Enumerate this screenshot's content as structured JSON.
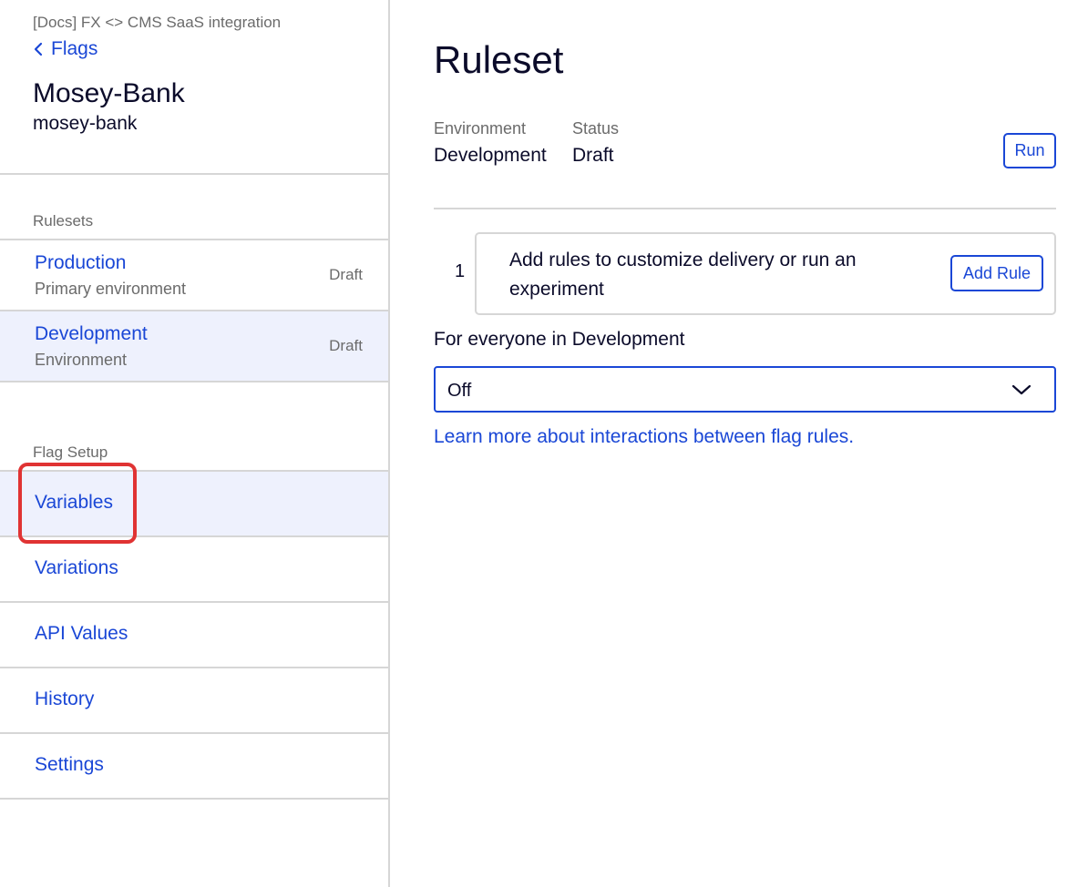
{
  "sidebar": {
    "project_name": "[Docs] FX <> CMS SaaS integration",
    "back_label": "Flags",
    "flag_name": "Mosey-Bank",
    "flag_key": "mosey-bank",
    "rulesets_heading": "Rulesets",
    "environments": [
      {
        "name": "Production",
        "subtitle": "Primary environment",
        "status": "Draft",
        "selected": false
      },
      {
        "name": "Development",
        "subtitle": "Environment",
        "status": "Draft",
        "selected": true
      }
    ],
    "flag_setup_heading": "Flag Setup",
    "setup_items": [
      {
        "label": "Variables",
        "active": true,
        "highlighted": true
      },
      {
        "label": "Variations",
        "active": false
      },
      {
        "label": "API Values",
        "active": false
      },
      {
        "label": "History",
        "active": false
      },
      {
        "label": "Settings",
        "active": false
      }
    ]
  },
  "main": {
    "title": "Ruleset",
    "environment_label": "Environment",
    "environment_value": "Development",
    "status_label": "Status",
    "status_value": "Draft",
    "run_button": "Run",
    "rule": {
      "number": "1",
      "text": "Add rules to customize delivery or run an experiment",
      "add_button": "Add Rule"
    },
    "everyone_label": "For everyone in Development",
    "select_value": "Off",
    "learn_more_link": "Learn more about interactions between flag rules."
  },
  "colors": {
    "link": "#1a47d6",
    "text": "#0b0b2a",
    "muted": "#6b6b6b",
    "selected_bg": "#eef1fd",
    "divider": "#d6d6d6",
    "highlight": "#e03333"
  },
  "icons": {
    "back": "chevron-left-icon",
    "select": "chevron-down-icon"
  }
}
